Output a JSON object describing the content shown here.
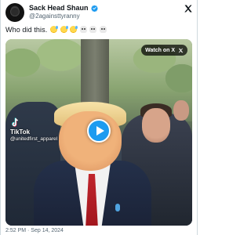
{
  "tweet": {
    "author_name": "Sack Head Shaun",
    "author_handle": "@2againsttyranny",
    "verified": true,
    "text": "Who did this.",
    "emojis": [
      "grinning-sweat",
      "grinning-sweat",
      "grinning-sweat",
      "skull",
      "skull",
      "skull"
    ],
    "timestamp": "2:52 PM · Sep 14, 2024"
  },
  "media": {
    "watch_label": "Watch on X",
    "watermark_brand": "TikTok",
    "watermark_user": "@unitedfirst_apparel",
    "play_icon": "play-icon"
  },
  "colors": {
    "accent": "#1d9bf0",
    "text": "#0f1419",
    "secondary_text": "#536471"
  }
}
